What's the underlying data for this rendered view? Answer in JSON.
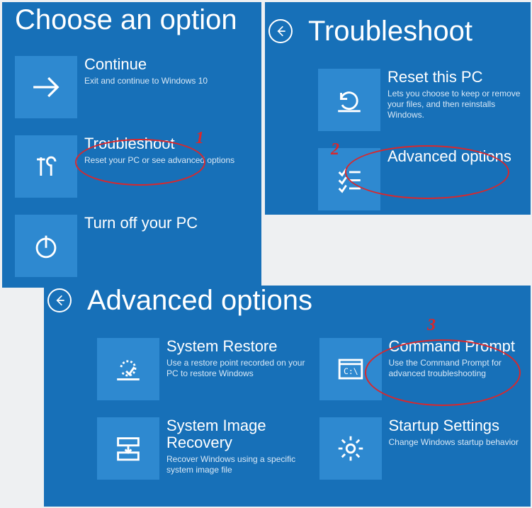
{
  "panel1": {
    "title": "Choose an option",
    "items": [
      {
        "title": "Continue",
        "desc": "Exit and continue to Windows 10"
      },
      {
        "title": "Troubleshoot",
        "desc": "Reset your PC or see advanced options"
      },
      {
        "title": "Turn off your PC",
        "desc": ""
      }
    ]
  },
  "panel2": {
    "title": "Troubleshoot",
    "items": [
      {
        "title": "Reset this PC",
        "desc": "Lets you choose to keep or remove your files, and then reinstalls Windows."
      },
      {
        "title": "Advanced options",
        "desc": ""
      }
    ]
  },
  "panel3": {
    "title": "Advanced options",
    "colA": [
      {
        "title": "System Restore",
        "desc": "Use a restore point recorded on your PC to restore Windows"
      },
      {
        "title": "System Image Recovery",
        "desc": "Recover Windows using a specific system image file"
      }
    ],
    "colB": [
      {
        "title": "Command Prompt",
        "desc": "Use the Command Prompt for advanced troubleshooting"
      },
      {
        "title": "Startup Settings",
        "desc": "Change Windows startup behavior"
      }
    ]
  },
  "annotations": {
    "n1": "1",
    "n2": "2",
    "n3": "3"
  }
}
